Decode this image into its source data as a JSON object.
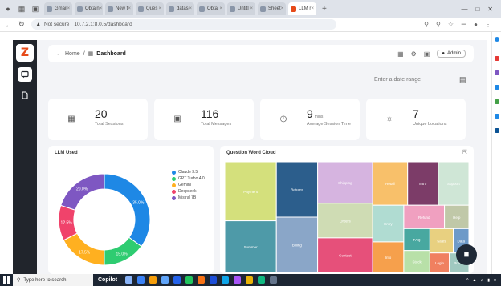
{
  "browser": {
    "tabs": [
      {
        "label": "Gmail",
        "active": false
      },
      {
        "label": "Obtain",
        "active": false
      },
      {
        "label": "New t",
        "active": false
      },
      {
        "label": "Ques",
        "active": false
      },
      {
        "label": "datas",
        "active": false
      },
      {
        "label": "Obtai",
        "active": false
      },
      {
        "label": "Untitl",
        "active": false
      },
      {
        "label": "Sheet",
        "active": false
      },
      {
        "label": "LLM r",
        "active": true
      }
    ],
    "security_label": "Not secure",
    "url": "10.7.2.1:8.0.5/dashboard"
  },
  "breadcrumb": {
    "home": "Home",
    "separator": "/",
    "current": "Dashboard"
  },
  "user_button": "Admin",
  "date_range_placeholder": "Enter a date range",
  "stats": [
    {
      "value": "20",
      "unit": "",
      "label": "Total Sessions",
      "icon": "chat-bubbles-icon"
    },
    {
      "value": "116",
      "unit": "",
      "label": "Total Messages",
      "icon": "message-icon"
    },
    {
      "value": "9",
      "unit": "mins",
      "label": "Average Session Time",
      "icon": "clock-icon"
    },
    {
      "value": "7",
      "unit": "",
      "label": "Unique Locations",
      "icon": "globe-icon"
    }
  ],
  "llm_panel": {
    "title": "LLM Used"
  },
  "chart_data": [
    {
      "type": "pie",
      "title": "LLM Used",
      "categories": [
        "Claude 3.5",
        "GPT Turbo 4.0",
        "Gemini",
        "Deepseek",
        "Mistral 7B"
      ],
      "values": [
        35.0,
        15.0,
        17.5,
        12.5,
        20.0
      ],
      "value_labels": [
        "35.0%",
        "15.0%",
        "17.5%",
        "12.5%",
        "20.0%"
      ],
      "colors": [
        "#1e88e5",
        "#2ecc71",
        "#ffb020",
        "#f0436b",
        "#7e57c2"
      ],
      "donut": true,
      "legend": "right"
    },
    {
      "type": "treemap",
      "title": "Question Word Cloud",
      "categories": [
        "Summer",
        "Entry",
        "Orders",
        "Returns",
        "Intro",
        "Retail",
        "Contact",
        "Support",
        "Help",
        "Billing",
        "Info",
        "Shipping",
        "Payment",
        "Refund",
        "FAQ",
        "Data",
        "Stock",
        "Sales",
        "Login",
        "Promo"
      ],
      "values": [
        14,
        6,
        10,
        12,
        7,
        8,
        10,
        7,
        3,
        12,
        5,
        12,
        16,
        5,
        3,
        2,
        3,
        3,
        2,
        2
      ],
      "colors": [
        "#4e9aa8",
        "#b0dcd2",
        "#cfdcb4",
        "#2c5e8c",
        "#7c3c68",
        "#f8c06a",
        "#e6507a",
        "#cfe6d6",
        "#c0c8a8",
        "#8aa6c8",
        "#f6a04c",
        "#d6b4e0",
        "#d4e07c",
        "#f0a0c0",
        "#48a8a0",
        "#6e9ac8",
        "#b8e0a8",
        "#e8d080",
        "#f08060",
        "#a0c8c0"
      ],
      "legend": "none"
    }
  ],
  "cloud_panel": {
    "title": "Question Word Cloud"
  },
  "taskbar": {
    "search_placeholder": "Type here to search",
    "copilot": "Copilot"
  }
}
